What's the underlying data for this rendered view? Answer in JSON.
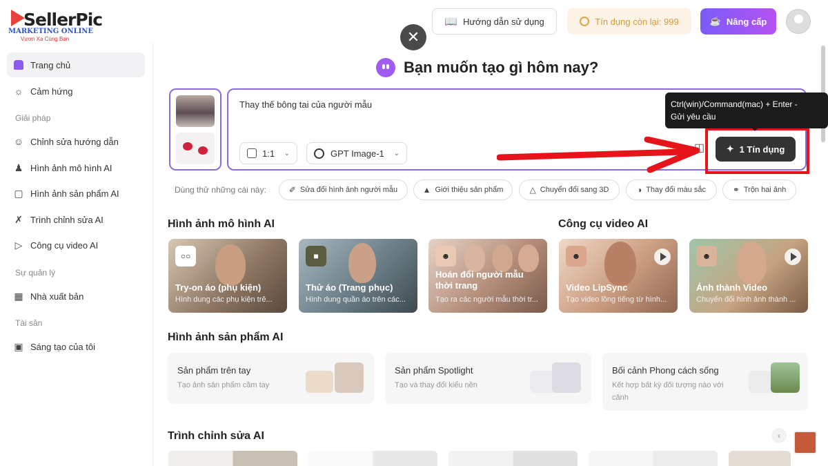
{
  "logo": {
    "name": "SellerPic",
    "subtitle": "MARKETING ONLINE",
    "tagline": "Vươn Xa Cùng Bạn"
  },
  "sidebar": {
    "items": [
      {
        "label": "Trang chủ",
        "icon": "home-icon"
      },
      {
        "label": "Cảm hứng",
        "icon": "lightbulb-icon"
      }
    ],
    "sections": [
      {
        "title": "Giải pháp",
        "items": [
          {
            "label": "Chỉnh sửa hướng dẫn",
            "icon": "smile-icon"
          },
          {
            "label": "Hình ảnh mô hình AI",
            "icon": "person-icon"
          },
          {
            "label": "Hình ảnh sản phẩm AI",
            "icon": "product-icon"
          },
          {
            "label": "Trình chỉnh sửa AI",
            "icon": "editor-icon"
          },
          {
            "label": "Công cụ video AI",
            "icon": "video-icon"
          }
        ]
      },
      {
        "title": "Sự quản lý",
        "items": [
          {
            "label": "Nhà xuất bản",
            "icon": "calendar-icon"
          }
        ]
      },
      {
        "title": "Tài sản",
        "items": [
          {
            "label": "Sáng tạo của tôi",
            "icon": "folder-icon"
          }
        ]
      }
    ]
  },
  "topbar": {
    "guide_label": "Hướng dẫn sử dụng",
    "credit_label": "Tín dụng còn lại: 999",
    "upgrade_label": "Nâng cấp"
  },
  "main": {
    "headline": "Bạn muốn tạo gì hôm nay?",
    "prompt_text": "Thay thế bông tai của người mẫu",
    "ratio": "1:1",
    "model": "GPT Image-1",
    "submit_label": "1 Tín dụng",
    "tooltip_line1": "Ctrl(win)/Command(mac) + Enter -",
    "tooltip_line2": "Gửi yêu cầu",
    "try_label": "Dùng thử những cái này:",
    "try_chips": [
      {
        "label": "Sửa đổi hình ảnh người mẫu",
        "icon": "edit-icon"
      },
      {
        "label": "Giới thiệu sản phẩm",
        "icon": "bottle-icon"
      },
      {
        "label": "Chuyển đổi sang 3D",
        "icon": "cube-icon"
      },
      {
        "label": "Thay đổi màu sắc",
        "icon": "palette-icon"
      },
      {
        "label": "Trộn hai ảnh",
        "icon": "blend-icon"
      }
    ]
  },
  "sections": {
    "model_title": "Hình ảnh mô hình AI",
    "video_title": "Công cụ video AI",
    "product_title": "Hình ảnh sản phẩm AI",
    "editor_title": "Trình chỉnh sửa AI"
  },
  "model_cards": [
    {
      "title": "Try-on áo (phụ kiện)",
      "desc": "Hình dung các phụ kiện trê..."
    },
    {
      "title": "Thử áo (Trang phục)",
      "desc": "Hình dung quần áo trên các..."
    },
    {
      "title": "Hoán đổi người mẫu thời trang",
      "desc": "Tạo ra các người mẫu thời tr..."
    }
  ],
  "video_cards": [
    {
      "title": "Video LipSync",
      "desc": "Tạo video lồng tiếng từ hình..."
    },
    {
      "title": "Ảnh thành Video",
      "desc": "Chuyển đổi hình ảnh thành ..."
    }
  ],
  "product_cards": [
    {
      "title": "Sản phẩm trên tay",
      "desc": "Tạo ảnh sản phẩm cầm tay"
    },
    {
      "title": "Sản phẩm Spotlight",
      "desc": "Tạo và thay đổi kiểu nền"
    },
    {
      "title": "Bối cảnh Phong cách sống",
      "desc": "Kết hợp bất kỳ đối tượng nào với cảnh"
    }
  ],
  "colors": {
    "accent": "#8a6ce0",
    "highlight": "#e6131a",
    "upgrade": "#9a58f4",
    "credit_text": "#d79a3a"
  }
}
